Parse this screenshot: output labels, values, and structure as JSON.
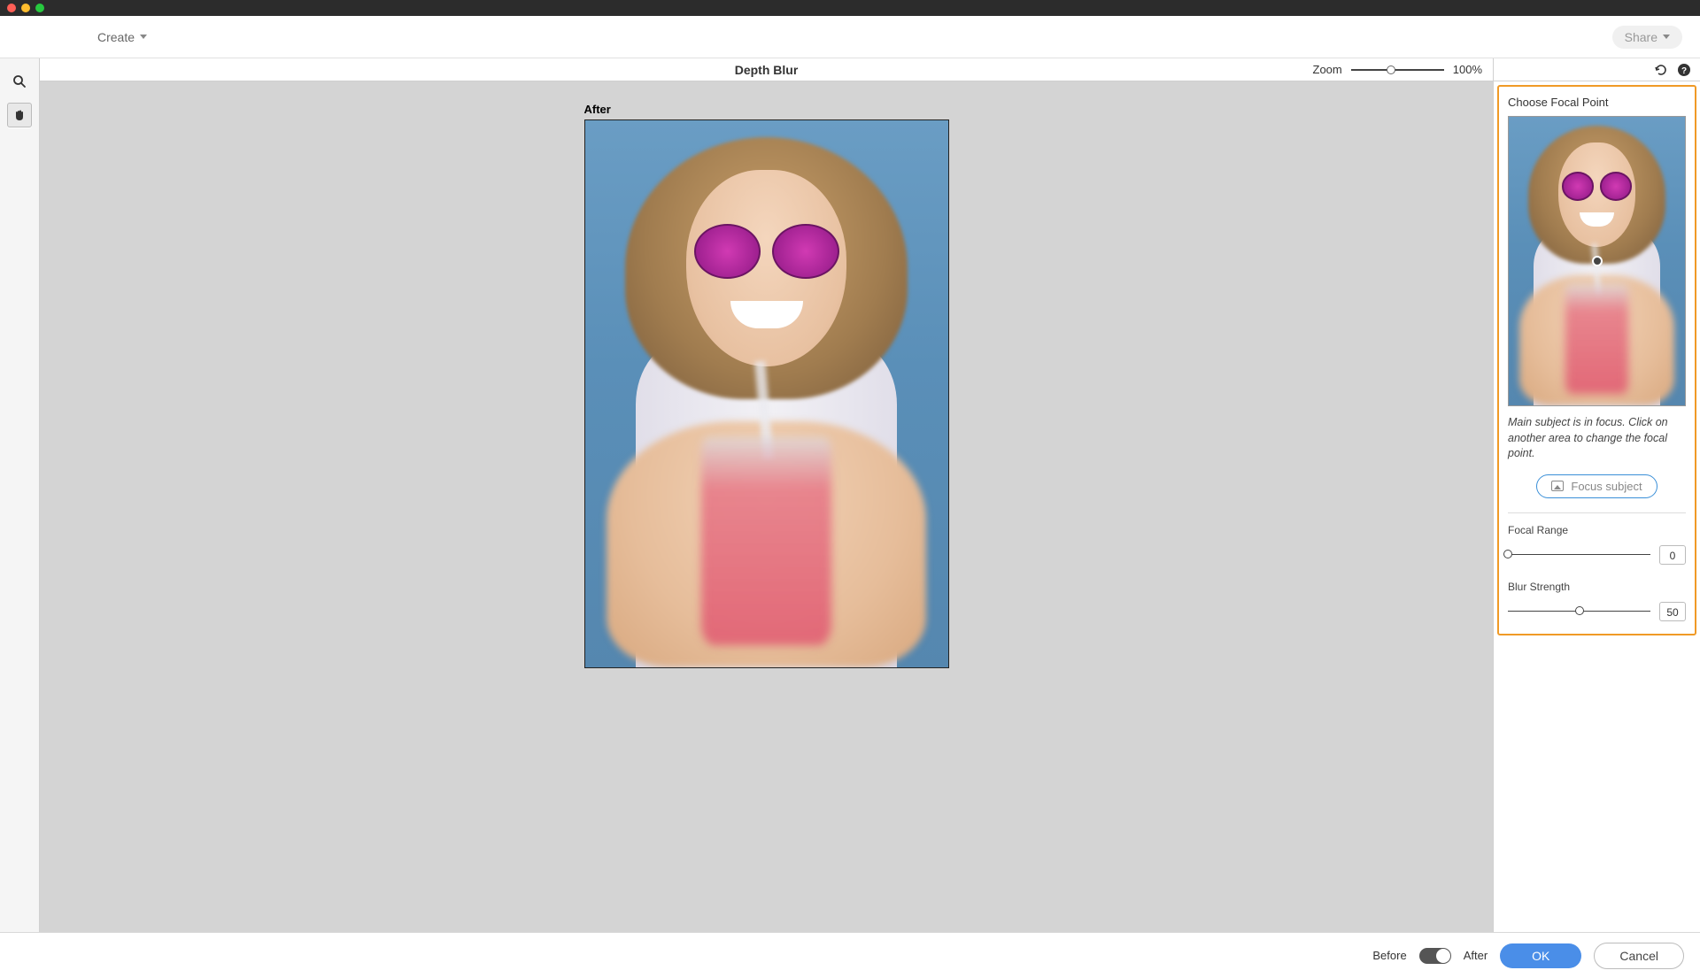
{
  "menubar": {
    "create_label": "Create",
    "share_label": "Share"
  },
  "canvas": {
    "feature_title": "Depth Blur",
    "zoom_label": "Zoom",
    "zoom_value": "100%",
    "image_label": "After"
  },
  "panel": {
    "title": "Choose Focal Point",
    "help_text": "Main subject is in focus. Click on another area to change the focal point.",
    "focus_subject_label": "Focus subject",
    "focal_range_label": "Focal Range",
    "focal_range_value": "0",
    "blur_strength_label": "Blur Strength",
    "blur_strength_value": "50"
  },
  "bottom": {
    "before_label": "Before",
    "after_label": "After",
    "ok_label": "OK",
    "cancel_label": "Cancel"
  }
}
